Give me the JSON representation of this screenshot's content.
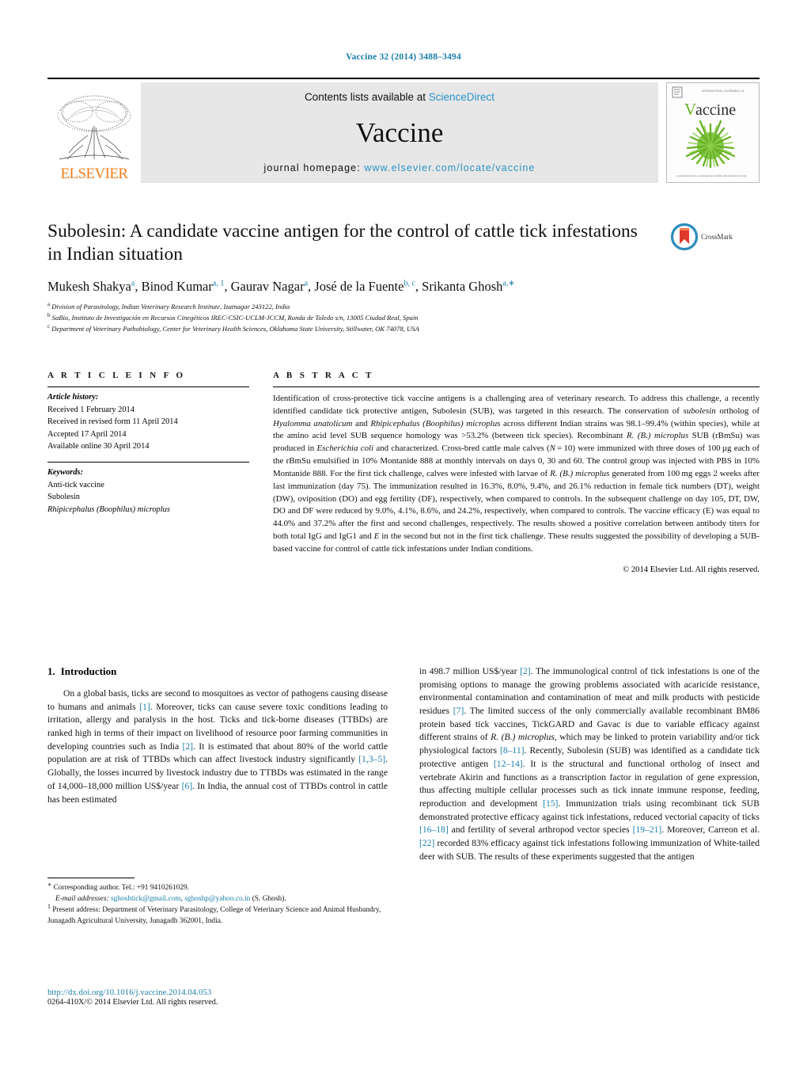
{
  "running_head": "Vaccine 32 (2014) 3488–3494",
  "masthead": {
    "contents_prefix": "Contents lists available at ",
    "sciencedirect": "ScienceDirect",
    "journal_name": "Vaccine",
    "homepage_prefix": "journal homepage: ",
    "homepage_url": "www.elsevier.com/locate/vaccine",
    "publisher": "ELSEVIER",
    "cover_title": "Vaccine",
    "cover_caption": "A journal devoted to vaccinology and to human and veterinary vaccines",
    "accent_link_color": "#2a93c8",
    "publisher_color": "#F07D1A"
  },
  "article": {
    "title": "Subolesin: A candidate vaccine antigen for the control of cattle tick infestations in Indian situation",
    "crossmark_label": "CrossMark",
    "authors_html": "Mukesh Shakya<sup>a</sup>, Binod Kumar<sup>a, 1</sup>, Gaurav Nagar<sup>a</sup>, José de la Fuente<sup>b, c</sup>, Srikanta Ghosh<sup>a,∗</sup>",
    "affiliations": [
      {
        "marker": "a",
        "text": "Division of Parasitology, Indian Veterinary Research Institute, Izatnagar 243122, India"
      },
      {
        "marker": "b",
        "text": "SaBio, Instituto de Investigación en Recursos Cinegéticos IREC-CSIC-UCLM-JCCM, Ronda de Toledo s/n, 13005 Ciudad Real, Spain"
      },
      {
        "marker": "c",
        "text": "Department of Veterinary Pathobiology, Center for Veterinary Health Sciences, Oklahoma State University, Stillwater, OK 74078, USA"
      }
    ]
  },
  "article_info": {
    "heading": "A R T I C L E   I N F O",
    "history_label": "Article history:",
    "history": [
      "Received 1 February 2014",
      "Received in revised form 11 April 2014",
      "Accepted 17 April 2014",
      "Available online 30 April 2014"
    ],
    "keywords_label": "Keywords:",
    "keywords": [
      "Anti-tick vaccine",
      "Subolesin",
      "Rhipicephalus (Boophilus) microplus"
    ]
  },
  "abstract": {
    "heading": "A B S T R A C T",
    "text_html": "Identification of cross-protective tick vaccine antigens is a challenging area of veterinary research. To address this challenge, a recently identified candidate tick protective antigen, Subolesin (SUB), was targeted in this research. The conservation of <em>subolesin</em> ortholog of <em>Hyalomma anatolicum</em> and <em>Rhipicephalus (Boophilus) microplus</em> across different Indian strains was 98.1–99.4% (within species), while at the amino acid level SUB sequence homology was &gt;53.2% (between tick species). Recombinant <em>R. (B.) microplus</em> SUB (rBmSu) was produced in <em>Escherichia coli</em> and characterized. Cross-bred cattle male calves (<em>N</em>&#8239;=&#8239;10) were immunized with three doses of 100&#8239;&#181;g each of the rBmSu emulsified in 10% Montanide 888 at monthly intervals on days 0, 30 and 60. The control group was injected with PBS in 10% Montanide 888. For the first tick challenge, calves were infested with larvae of <em>R. (B.) microplus</em> generated from 100&#8239;mg eggs 2 weeks after last immunization (day 75). The immunization resulted in 16.3%, 8.0%, 9.4%, and 26.1% reduction in female tick numbers (DT), weight (DW), oviposition (DO) and egg fertility (DF), respectively, when compared to controls. In the subsequent challenge on day 105, DT, DW, DO and DF were reduced by 9.0%, 4.1%, 8.6%, and 24.2%, respectively, when compared to controls. The vaccine efficacy (E) was equal to 44.0% and 37.2% after the first and second challenges, respectively. The results showed a positive correlation between antibody titers for both total IgG and IgG1 and <em>E</em> in the second but not in the first tick challenge. These results suggested the possibility of developing a SUB-based vaccine for control of cattle tick infestations under Indian conditions.",
    "copyright": "© 2014 Elsevier Ltd. All rights reserved."
  },
  "introduction": {
    "number": "1.",
    "heading": "Introduction",
    "left_paragraph_html": "On a global basis, ticks are second to mosquitoes as vector of pathogens causing disease to humans and animals <span class=\"cite\">[1]</span>. Moreover, ticks can cause severe toxic conditions leading to irritation, allergy and paralysis in the host. Ticks and tick-borne diseases (TTBDs) are ranked high in terms of their impact on livelihood of resource poor farming communities in developing countries such as India <span class=\"cite\">[2]</span>. It is estimated that about 80% of the world cattle population are at risk of TTBDs which can affect livestock industry significantly <span class=\"cite\">[1,3–5]</span>. Globally, the losses incurred by livestock industry due to TTBDs was estimated in the range of 14,000–18,000 million US$/year <span class=\"cite\">[6]</span>. In India, the annual cost of TTBDs control in cattle has been estimated",
    "right_paragraph_html": "in 498.7 million US$/year <span class=\"cite\">[2]</span>. The immunological control of tick infestations is one of the promising options to manage the growing problems associated with acaricide resistance, environmental contamination and contamination of meat and milk products with pesticide residues <span class=\"cite\">[7]</span>. The limited success of the only commercially available recombinant BM86 protein based tick vaccines, TickGARD and Gavac is due to variable efficacy against different strains of <em>R. (B.) microplus</em>, which may be linked to protein variability and/or tick physiological factors <span class=\"cite\">[8–11]</span>. Recently, Subolesin (SUB) was identified as a candidate tick protective antigen <span class=\"cite\">[12–14]</span>. It is the structural and functional ortholog of insect and vertebrate Akirin and functions as a transcription factor in regulation of gene expression, thus affecting multiple cellular processes such as tick innate immune response, feeding, reproduction and development <span class=\"cite\">[15]</span>. Immunization trials using recombinant tick SUB demonstrated protective efficacy against tick infestations, reduced vectorial capacity of ticks <span class=\"cite\">[16–18]</span> and fertility of several arthropod vector species <span class=\"cite\">[19–21]</span>. Moreover, Carreon et al. <span class=\"cite\">[22]</span> recorded 83% efficacy against tick infestations following immunization of White-tailed deer with SUB. The results of these experiments suggested that the antigen"
  },
  "footnotes": {
    "corresponding_html": "<sup>∗</sup>&nbsp;Corresponding author. Tel.: +91 9410261029.",
    "email_label": "E-mail addresses:",
    "email_1": "sghoshtick@gmail.com",
    "email_2": "sghoshp@yahoo.co.in",
    "email_suffix": "(S. Ghosh).",
    "present_address_html": "<sup>1</sup>&nbsp;Present address: Department of Veterinary Parasitology, College of Veterinary Science and Animal Husbandry, Junagadh Agricultural University, Junagadh 362001, India."
  },
  "footer": {
    "doi": "http://dx.doi.org/10.1016/j.vaccine.2014.04.053",
    "issn_line": "0264-410X/© 2014 Elsevier Ltd. All rights reserved."
  }
}
